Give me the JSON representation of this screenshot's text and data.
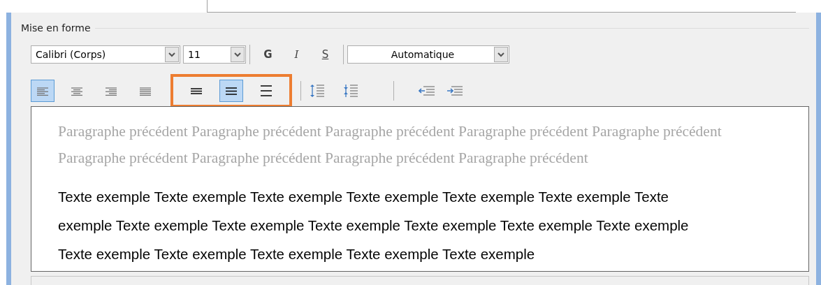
{
  "section_title": "Mise en forme",
  "font": {
    "value": "Calibri (Corps)"
  },
  "size": {
    "value": "11"
  },
  "style_buttons": [
    {
      "label": "G",
      "kind": "bold"
    },
    {
      "label": "I",
      "kind": "italic"
    },
    {
      "label": "S",
      "kind": "underline"
    }
  ],
  "color": {
    "value": "Automatique"
  },
  "alignment": [
    {
      "kind": "left",
      "selected": true
    },
    {
      "kind": "center",
      "selected": false
    },
    {
      "kind": "right",
      "selected": false
    },
    {
      "kind": "justify",
      "selected": false
    }
  ],
  "spacing": {
    "highlighted": true,
    "buttons": [
      {
        "kind": "single",
        "selected": false
      },
      {
        "kind": "one-half",
        "selected": true
      },
      {
        "kind": "double",
        "selected": false
      }
    ]
  },
  "paragraph_spacing": [
    {
      "kind": "increase"
    },
    {
      "kind": "decrease"
    }
  ],
  "indent": [
    {
      "kind": "decrease"
    },
    {
      "kind": "increase"
    }
  ],
  "preview": {
    "previous_lines": [
      "Paragraphe précédent Paragraphe précédent Paragraphe précédent Paragraphe précédent Paragraphe précédent",
      "Paragraphe précédent Paragraphe précédent Paragraphe précédent Paragraphe précédent"
    ],
    "sample_lines": [
      "Texte exemple Texte exemple Texte exemple Texte exemple Texte exemple Texte exemple Texte",
      "exemple Texte exemple Texte exemple Texte exemple Texte exemple Texte exemple Texte exemple",
      "Texte exemple Texte exemple Texte exemple Texte exemple Texte exemple"
    ]
  }
}
